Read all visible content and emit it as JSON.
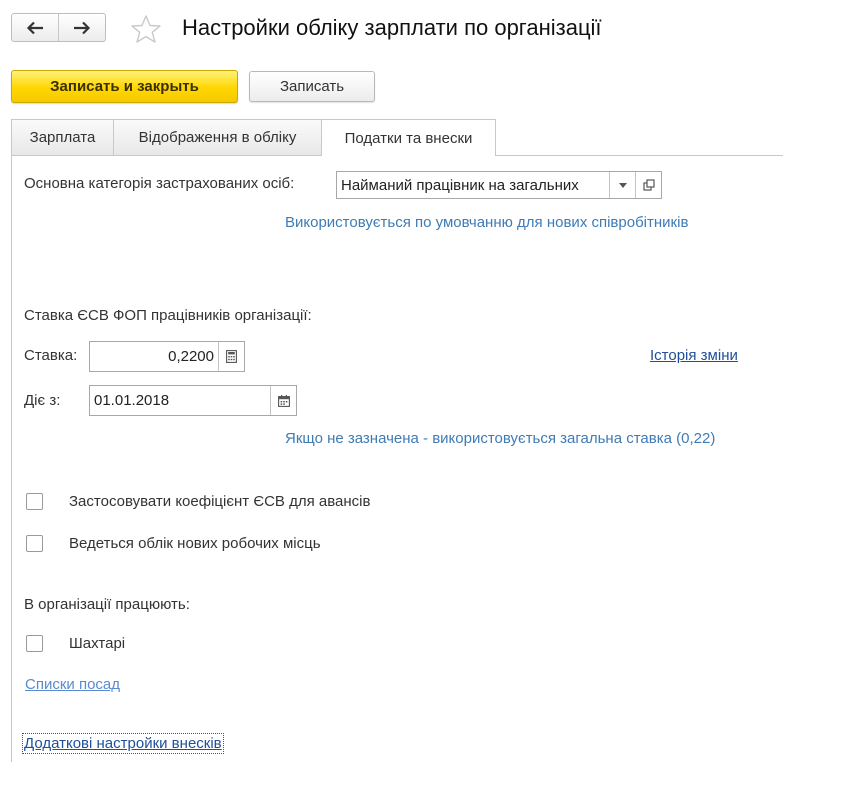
{
  "header": {
    "title": "Настройки обліку зарплати по організації",
    "back_icon": "arrow-left-icon",
    "forward_icon": "arrow-right-icon",
    "favorite_icon": "star-icon"
  },
  "toolbar": {
    "save_close_label": "Записать и закрыть",
    "save_label": "Записать"
  },
  "tabs": [
    {
      "label": "Зарплата",
      "active": false
    },
    {
      "label": "Відображення в обліку",
      "active": false
    },
    {
      "label": "Податки та внески",
      "active": true
    }
  ],
  "insured": {
    "label": "Основна категорія застрахованих осіб:",
    "value": "Найманий працівник на загальних",
    "hint": "Використовується по умовчанню для нових співробітників"
  },
  "esv": {
    "section_label": "Ставка ЄСВ ФОП працівників організації:",
    "rate_label": "Ставка:",
    "rate_value": "0,2200",
    "history_link": "Історія зміни",
    "date_label": "Діє з:",
    "date_value": "01.01.2018",
    "hint": "Якщо не зазначена - використовується загальна ставка (0,22)"
  },
  "checkboxes": {
    "coef_label": "Застосовувати коефіцієнт ЄСВ для авансів",
    "coef_checked": false,
    "jobs_label": "Ведеться облік нових робочих місць",
    "jobs_checked": false
  },
  "workers": {
    "section_label": "В організації працюють:",
    "miners_label": "Шахтарі",
    "miners_checked": false,
    "positions_link": "Списки посад"
  },
  "additional_link": "Додаткові настройки внесків",
  "colors": {
    "primary_button": "#ffd600",
    "hint_text": "#3f7bb5",
    "link_text": "#1f4f9a"
  }
}
